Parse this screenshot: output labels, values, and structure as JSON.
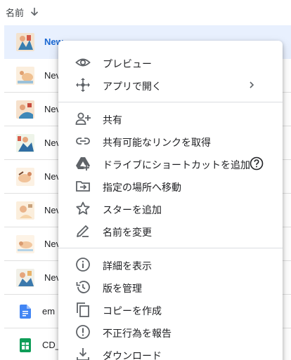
{
  "header": {
    "name_label": "名前",
    "sort_icon": "arrow-down-icon"
  },
  "files": [
    {
      "name": "New",
      "visible_name": "New",
      "selected": true,
      "shared_glyph": "·•·",
      "type": "image"
    },
    {
      "name": "Nev",
      "type": "image"
    },
    {
      "name": "Nev",
      "type": "image"
    },
    {
      "name": "Nev",
      "type": "image"
    },
    {
      "name": "Nev",
      "type": "image"
    },
    {
      "name": "Nev",
      "type": "image"
    },
    {
      "name": "Nev",
      "type": "image"
    },
    {
      "name": "Nev",
      "type": "image"
    },
    {
      "name": "em",
      "type": "doc",
      "icon": "google-docs-icon",
      "color": "#4285f4"
    },
    {
      "name": "CD_",
      "type": "sheet",
      "icon": "google-sheets-icon",
      "color": "#0f9d58"
    }
  ],
  "menu": {
    "preview": "プレビュー",
    "open_with": "アプリで開く",
    "share": "共有",
    "get_link": "共有可能なリンクを取得",
    "add_shortcut": "ドライブにショートカットを追加",
    "move_to": "指定の場所へ移動",
    "add_star": "スターを追加",
    "rename": "名前を変更",
    "details": "詳細を表示",
    "manage_versions": "版を管理",
    "make_copy": "コピーを作成",
    "report_abuse": "不正行為を報告",
    "download": "ダウンロード"
  },
  "colors": {
    "selected_bg": "#e8f0fe",
    "accent": "#1967d2",
    "icon_gray": "#5f6368"
  }
}
